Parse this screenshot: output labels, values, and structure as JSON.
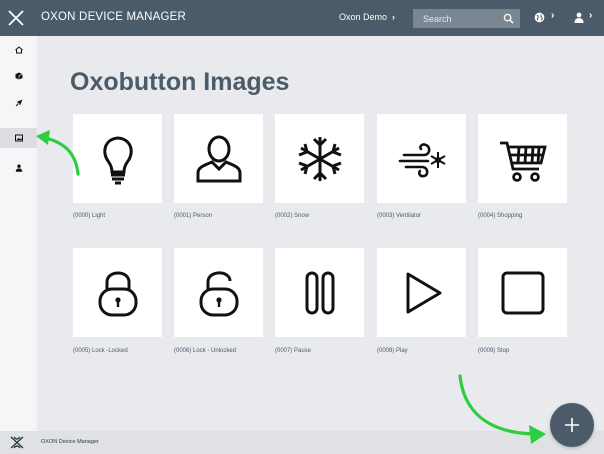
{
  "header": {
    "app_title": "OXON DEVICE MANAGER",
    "account_label": "Oxon Demo",
    "search_placeholder": "Search"
  },
  "page": {
    "title": "Oxobutton Images"
  },
  "images": [
    {
      "caption": "(0000) Light",
      "icon": "lightbulb-icon"
    },
    {
      "caption": "(0001) Person",
      "icon": "person-icon"
    },
    {
      "caption": "(0002) Snow",
      "icon": "snowflake-icon"
    },
    {
      "caption": "(0003) Ventilator",
      "icon": "ventilator-icon"
    },
    {
      "caption": "(0004) Shopping",
      "icon": "shopping-cart-icon"
    },
    {
      "caption": "(0005) Lock -Locked",
      "icon": "lock-locked-icon"
    },
    {
      "caption": "(0006) Lock - Unlocked",
      "icon": "lock-unlocked-icon"
    },
    {
      "caption": "(0007) Pause",
      "icon": "pause-icon"
    },
    {
      "caption": "(0008) Play",
      "icon": "play-icon"
    },
    {
      "caption": "(0009) Stop",
      "icon": "stop-icon"
    }
  ],
  "sidebar": {
    "items": [
      {
        "icon": "home-icon"
      },
      {
        "icon": "cube-icon"
      },
      {
        "icon": "rocket-icon"
      },
      {
        "icon": "image-icon",
        "active": true
      },
      {
        "icon": "user-icon"
      }
    ]
  },
  "footer": {
    "text": "OXON Device Manager"
  },
  "colors": {
    "topbar": "#4b5b69",
    "background": "#e9eaed",
    "accent_arrow": "#2ecc40"
  }
}
